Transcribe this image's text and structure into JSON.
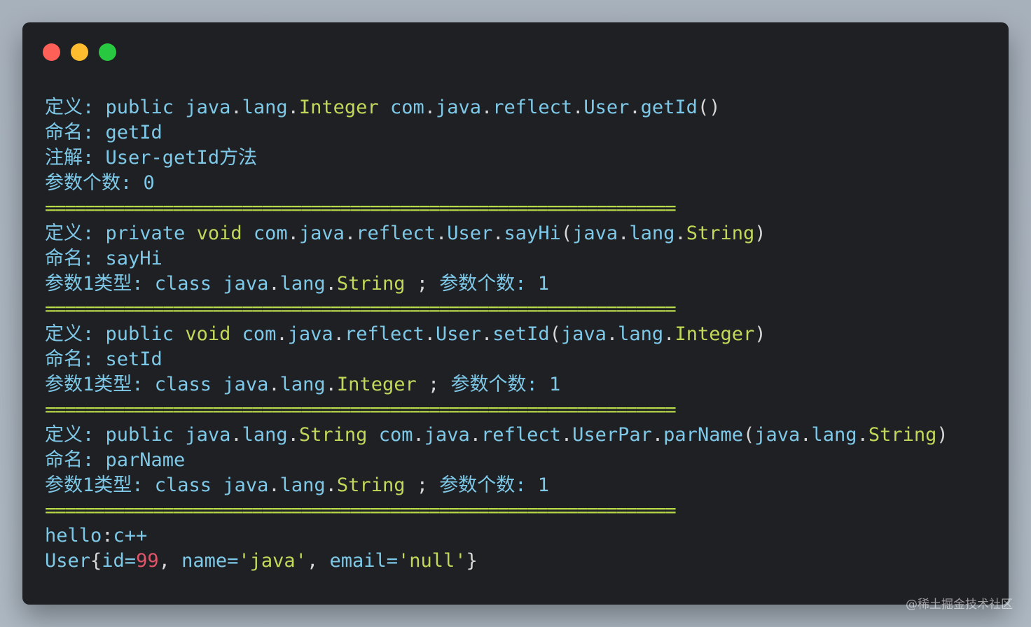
{
  "window": {
    "controls": [
      {
        "name": "close",
        "color": "#fe5f57"
      },
      {
        "name": "minimize",
        "color": "#febc2e"
      },
      {
        "name": "maximize",
        "color": "#28c840"
      }
    ]
  },
  "output": {
    "lines": [
      {
        "type": "text",
        "parts": [
          {
            "t": "定义: ",
            "c": "plain"
          },
          {
            "t": "public ",
            "c": "plain"
          },
          {
            "t": "java",
            "c": "plain"
          },
          {
            "t": ".",
            "c": "punc"
          },
          {
            "t": "lang",
            "c": "plain"
          },
          {
            "t": ".",
            "c": "punc"
          },
          {
            "t": "Integer ",
            "c": "kw"
          },
          {
            "t": "com",
            "c": "plain"
          },
          {
            "t": ".",
            "c": "punc"
          },
          {
            "t": "java",
            "c": "plain"
          },
          {
            "t": ".",
            "c": "punc"
          },
          {
            "t": "reflect",
            "c": "plain"
          },
          {
            "t": ".",
            "c": "punc"
          },
          {
            "t": "User",
            "c": "plain"
          },
          {
            "t": ".",
            "c": "punc"
          },
          {
            "t": "getId",
            "c": "plain"
          },
          {
            "t": "()",
            "c": "punc"
          }
        ]
      },
      {
        "type": "text",
        "parts": [
          {
            "t": "命名: ",
            "c": "plain"
          },
          {
            "t": "getId",
            "c": "plain"
          }
        ]
      },
      {
        "type": "text",
        "parts": [
          {
            "t": "注解: ",
            "c": "plain"
          },
          {
            "t": "User-getId方法",
            "c": "plain"
          }
        ]
      },
      {
        "type": "text",
        "parts": [
          {
            "t": "参数个数: ",
            "c": "plain"
          },
          {
            "t": "0",
            "c": "plain"
          }
        ]
      },
      {
        "type": "sep",
        "text": "================================================================"
      },
      {
        "type": "text",
        "parts": [
          {
            "t": "定义: ",
            "c": "plain"
          },
          {
            "t": "private ",
            "c": "plain"
          },
          {
            "t": "void ",
            "c": "kw"
          },
          {
            "t": "com",
            "c": "plain"
          },
          {
            "t": ".",
            "c": "punc"
          },
          {
            "t": "java",
            "c": "plain"
          },
          {
            "t": ".",
            "c": "punc"
          },
          {
            "t": "reflect",
            "c": "plain"
          },
          {
            "t": ".",
            "c": "punc"
          },
          {
            "t": "User",
            "c": "plain"
          },
          {
            "t": ".",
            "c": "punc"
          },
          {
            "t": "sayHi",
            "c": "plain"
          },
          {
            "t": "(",
            "c": "punc"
          },
          {
            "t": "java",
            "c": "plain"
          },
          {
            "t": ".",
            "c": "punc"
          },
          {
            "t": "lang",
            "c": "plain"
          },
          {
            "t": ".",
            "c": "punc"
          },
          {
            "t": "String",
            "c": "kw"
          },
          {
            "t": ")",
            "c": "punc"
          }
        ]
      },
      {
        "type": "text",
        "parts": [
          {
            "t": "命名: ",
            "c": "plain"
          },
          {
            "t": "sayHi",
            "c": "plain"
          }
        ]
      },
      {
        "type": "text",
        "parts": [
          {
            "t": "参数1类型: ",
            "c": "plain"
          },
          {
            "t": "class ",
            "c": "plain"
          },
          {
            "t": "java",
            "c": "plain"
          },
          {
            "t": ".",
            "c": "punc"
          },
          {
            "t": "lang",
            "c": "plain"
          },
          {
            "t": ".",
            "c": "punc"
          },
          {
            "t": "String ",
            "c": "kw"
          },
          {
            "t": "; ",
            "c": "punc"
          },
          {
            "t": "参数个数: ",
            "c": "plain"
          },
          {
            "t": "1",
            "c": "plain"
          }
        ]
      },
      {
        "type": "sep",
        "text": "================================================================"
      },
      {
        "type": "text",
        "parts": [
          {
            "t": "定义: ",
            "c": "plain"
          },
          {
            "t": "public ",
            "c": "plain"
          },
          {
            "t": "void ",
            "c": "kw"
          },
          {
            "t": "com",
            "c": "plain"
          },
          {
            "t": ".",
            "c": "punc"
          },
          {
            "t": "java",
            "c": "plain"
          },
          {
            "t": ".",
            "c": "punc"
          },
          {
            "t": "reflect",
            "c": "plain"
          },
          {
            "t": ".",
            "c": "punc"
          },
          {
            "t": "User",
            "c": "plain"
          },
          {
            "t": ".",
            "c": "punc"
          },
          {
            "t": "setId",
            "c": "plain"
          },
          {
            "t": "(",
            "c": "punc"
          },
          {
            "t": "java",
            "c": "plain"
          },
          {
            "t": ".",
            "c": "punc"
          },
          {
            "t": "lang",
            "c": "plain"
          },
          {
            "t": ".",
            "c": "punc"
          },
          {
            "t": "Integer",
            "c": "kw"
          },
          {
            "t": ")",
            "c": "punc"
          }
        ]
      },
      {
        "type": "text",
        "parts": [
          {
            "t": "命名: ",
            "c": "plain"
          },
          {
            "t": "setId",
            "c": "plain"
          }
        ]
      },
      {
        "type": "text",
        "parts": [
          {
            "t": "参数1类型: ",
            "c": "plain"
          },
          {
            "t": "class ",
            "c": "plain"
          },
          {
            "t": "java",
            "c": "plain"
          },
          {
            "t": ".",
            "c": "punc"
          },
          {
            "t": "lang",
            "c": "plain"
          },
          {
            "t": ".",
            "c": "punc"
          },
          {
            "t": "Integer ",
            "c": "kw"
          },
          {
            "t": "; ",
            "c": "punc"
          },
          {
            "t": "参数个数: ",
            "c": "plain"
          },
          {
            "t": "1",
            "c": "plain"
          }
        ]
      },
      {
        "type": "sep",
        "text": "================================================================"
      },
      {
        "type": "text",
        "parts": [
          {
            "t": "定义: ",
            "c": "plain"
          },
          {
            "t": "public ",
            "c": "plain"
          },
          {
            "t": "java",
            "c": "plain"
          },
          {
            "t": ".",
            "c": "punc"
          },
          {
            "t": "lang",
            "c": "plain"
          },
          {
            "t": ".",
            "c": "punc"
          },
          {
            "t": "String ",
            "c": "kw"
          },
          {
            "t": "com",
            "c": "plain"
          },
          {
            "t": ".",
            "c": "punc"
          },
          {
            "t": "java",
            "c": "plain"
          },
          {
            "t": ".",
            "c": "punc"
          },
          {
            "t": "reflect",
            "c": "plain"
          },
          {
            "t": ".",
            "c": "punc"
          },
          {
            "t": "UserPar",
            "c": "plain"
          },
          {
            "t": ".",
            "c": "punc"
          },
          {
            "t": "parName",
            "c": "plain"
          },
          {
            "t": "(",
            "c": "punc"
          },
          {
            "t": "java",
            "c": "plain"
          },
          {
            "t": ".",
            "c": "punc"
          },
          {
            "t": "lang",
            "c": "plain"
          },
          {
            "t": ".",
            "c": "punc"
          },
          {
            "t": "String",
            "c": "kw"
          },
          {
            "t": ")",
            "c": "punc"
          }
        ]
      },
      {
        "type": "text",
        "parts": [
          {
            "t": "命名: ",
            "c": "plain"
          },
          {
            "t": "parName",
            "c": "plain"
          }
        ]
      },
      {
        "type": "text",
        "parts": [
          {
            "t": "参数1类型: ",
            "c": "plain"
          },
          {
            "t": "class ",
            "c": "plain"
          },
          {
            "t": "java",
            "c": "plain"
          },
          {
            "t": ".",
            "c": "punc"
          },
          {
            "t": "lang",
            "c": "plain"
          },
          {
            "t": ".",
            "c": "punc"
          },
          {
            "t": "String ",
            "c": "kw"
          },
          {
            "t": "; ",
            "c": "punc"
          },
          {
            "t": "参数个数: ",
            "c": "plain"
          },
          {
            "t": "1",
            "c": "plain"
          }
        ]
      },
      {
        "type": "sep",
        "text": "================================================================"
      },
      {
        "type": "text",
        "parts": [
          {
            "t": "hello",
            "c": "plain"
          },
          {
            "t": ":",
            "c": "punc"
          },
          {
            "t": "c++",
            "c": "plain"
          }
        ]
      },
      {
        "type": "text",
        "parts": [
          {
            "t": "User",
            "c": "plain"
          },
          {
            "t": "{",
            "c": "punc"
          },
          {
            "t": "id=",
            "c": "plain"
          },
          {
            "t": "99",
            "c": "num"
          },
          {
            "t": ", ",
            "c": "punc"
          },
          {
            "t": "name=",
            "c": "plain"
          },
          {
            "t": "'java'",
            "c": "str"
          },
          {
            "t": ", ",
            "c": "punc"
          },
          {
            "t": "email=",
            "c": "plain"
          },
          {
            "t": "'null'",
            "c": "str"
          },
          {
            "t": "}",
            "c": "punc"
          }
        ]
      }
    ]
  },
  "watermark": "@稀土掘金技术社区"
}
